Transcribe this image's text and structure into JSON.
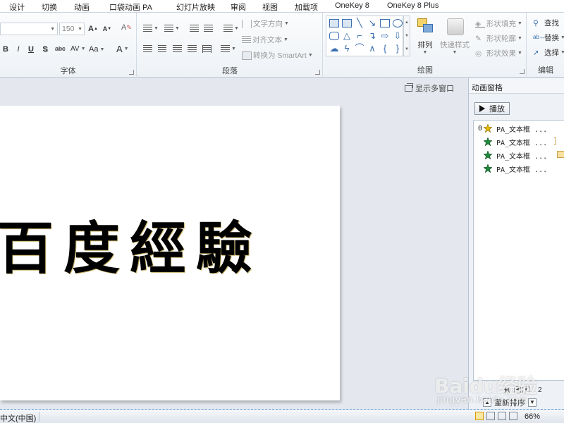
{
  "tabs": [
    "设计",
    "切换",
    "动画",
    "口袋动画 PA",
    "幻灯片放映",
    "审阅",
    "视图",
    "加载项",
    "OneKey 8",
    "OneKey 8 Plus"
  ],
  "ribbon": {
    "font": {
      "label": "字体",
      "font_size": "150",
      "grow_font": "A",
      "shrink_font": "A",
      "bold": "B",
      "italic": "I",
      "underline": "U",
      "strike": "S",
      "abc": "abc",
      "spacing": "AV",
      "change_case": "Aa",
      "font_color": "A"
    },
    "paragraph": {
      "label": "段落",
      "text_direction": "文字方向",
      "align_text": "对齐文本",
      "convert_smartart": "转换为 SmartArt"
    },
    "drawing": {
      "label": "绘图",
      "arrange": "排列",
      "quick_styles": "快速样式",
      "shape_fill": "形状填充",
      "shape_outline": "形状轮廓",
      "shape_effects": "形状效果"
    },
    "editing": {
      "label": "编辑",
      "find": "查找",
      "replace": "替换",
      "select": "选择"
    }
  },
  "slide_area": {
    "multi_window": "显示多窗口",
    "slide_text": "百度經驗"
  },
  "animation_pane": {
    "title": "动画窗格",
    "play": "播放",
    "items": [
      {
        "num": "0",
        "label": "PA_文本框 ...",
        "icon": "star-yellow-icon"
      },
      {
        "num": "",
        "label": "PA_文本框 ...",
        "icon": "star-green-icon"
      },
      {
        "num": "",
        "label": "PA_文本框 ...",
        "icon": "star-green-icon"
      },
      {
        "num": "",
        "label": "PA_文本框 ...",
        "icon": "star-green-icon"
      }
    ],
    "seconds_label": "秒",
    "timeline_value": "2",
    "reorder": "重新排序"
  },
  "status": {
    "language": "中文(中国)",
    "zoom": "66%"
  },
  "watermark": {
    "main": "Baidu经验",
    "sub": "jingyan.baidu.com"
  },
  "colors": {
    "accent": "#3a6fb0",
    "star_green": "#1f8a3c",
    "star_yellow": "#e6b800",
    "timing_bar": "#fbe1a0"
  }
}
